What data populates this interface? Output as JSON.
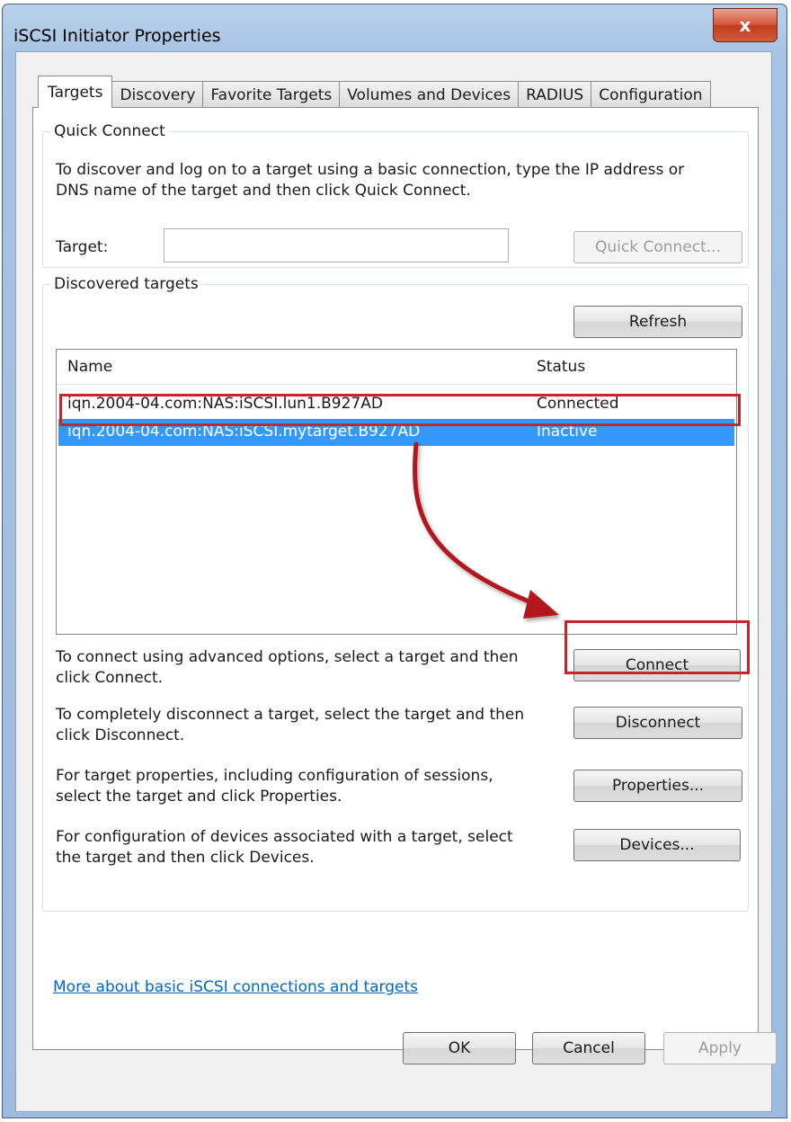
{
  "window": {
    "title": "iSCSI Initiator Properties",
    "close_glyph": "x"
  },
  "tabs": [
    {
      "label": "Targets",
      "active": true
    },
    {
      "label": "Discovery",
      "active": false
    },
    {
      "label": "Favorite Targets",
      "active": false
    },
    {
      "label": "Volumes and Devices",
      "active": false
    },
    {
      "label": "RADIUS",
      "active": false
    },
    {
      "label": "Configuration",
      "active": false
    }
  ],
  "quick_connect": {
    "legend": "Quick Connect",
    "description": "To discover and log on to a target using a basic connection, type the IP address or DNS name of the target and then click Quick Connect.",
    "target_label": "Target:",
    "target_value": "",
    "button_label": "Quick Connect..."
  },
  "discovered": {
    "legend": "Discovered targets",
    "refresh_label": "Refresh",
    "columns": {
      "name": "Name",
      "status": "Status"
    },
    "rows": [
      {
        "name": "iqn.2004-04.com:NAS:iSCSI.lun1.B927AD",
        "status": "Connected",
        "selected": false
      },
      {
        "name": "iqn.2004-04.com:NAS:iSCSI.mytarget.B927AD",
        "status": "Inactive",
        "selected": true
      }
    ],
    "actions": [
      {
        "text": "To connect using advanced options, select a target and then click Connect.",
        "button": "Connect"
      },
      {
        "text": "To completely disconnect a target, select the target and then click Disconnect.",
        "button": "Disconnect"
      },
      {
        "text": "For target properties, including configuration of sessions, select the target and click Properties.",
        "button": "Properties..."
      },
      {
        "text": "For configuration of devices associated with a target, select the target and then click Devices.",
        "button": "Devices..."
      }
    ]
  },
  "help_link": "More about basic iSCSI connections and targets",
  "footer": {
    "ok": "OK",
    "cancel": "Cancel",
    "apply": "Apply"
  },
  "colors": {
    "selection": "#3399ff",
    "annotation": "#c4262b",
    "link": "#0066cc"
  }
}
